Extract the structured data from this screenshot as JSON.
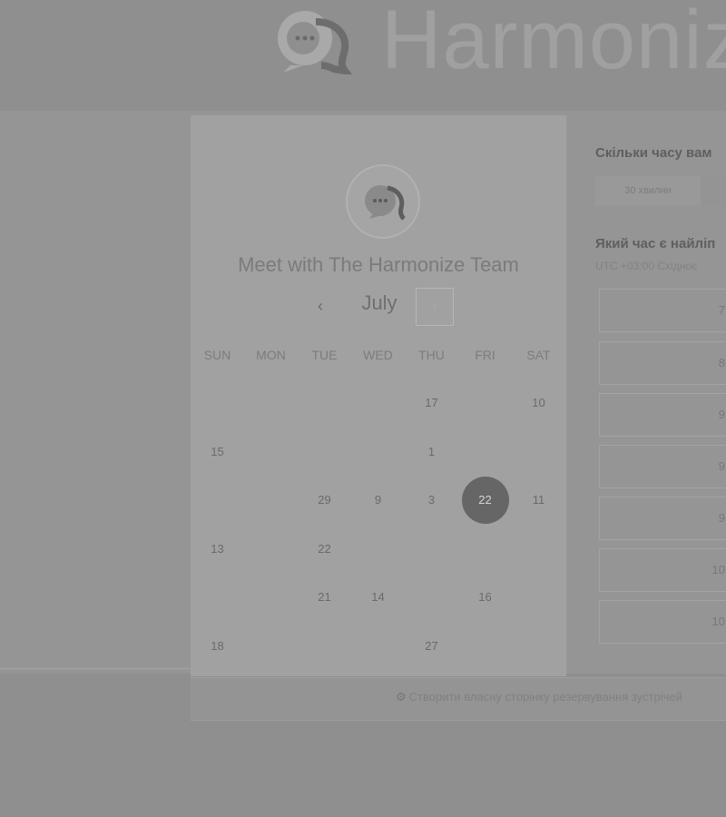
{
  "brand": {
    "name": "Harmonize"
  },
  "calendar": {
    "meeting_title": "Meet with The Harmonize Team",
    "month": "July",
    "prev_icon": "‹",
    "next_icon": "›",
    "weekdays": [
      "SUN",
      "MON",
      "TUE",
      "WED",
      "THU",
      "FRI",
      "SAT"
    ],
    "weeks": [
      [
        "",
        "",
        "",
        "",
        "17",
        "",
        "10"
      ],
      [
        "15",
        "",
        "",
        "",
        "1",
        "",
        ""
      ],
      [
        "",
        "",
        "29",
        "9",
        "3",
        "22",
        "11"
      ],
      [
        "13",
        "",
        "22",
        "",
        "",
        "",
        ""
      ],
      [
        "",
        "",
        "21",
        "14",
        "",
        "16",
        ""
      ],
      [
        "18",
        "",
        "",
        "",
        "27",
        "",
        ""
      ]
    ],
    "selected_day": "22"
  },
  "sidebar_right": {
    "question_duration": "Скільки часу вам",
    "duration_option": "30 хвилин",
    "question_time": "Який час є найліп",
    "timezone": "UTC +03:00 Східноє",
    "slots": [
      "7",
      "8",
      "9",
      "9",
      "9",
      "10",
      "10"
    ]
  },
  "footer": {
    "link_icon": "hubspot-sprocket-icon",
    "link_text": "Створити власну сторінку резервування зустрічей"
  }
}
